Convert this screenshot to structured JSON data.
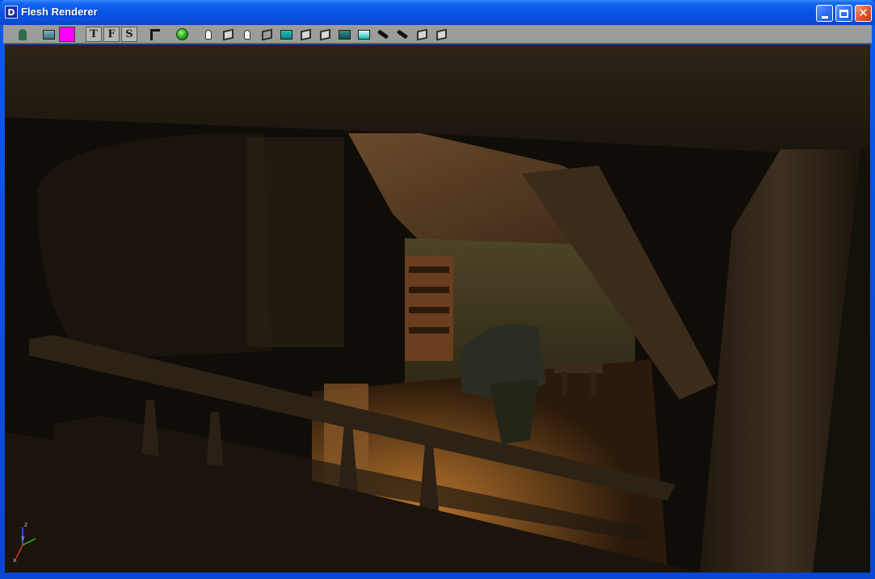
{
  "window": {
    "title": "Flesh Renderer",
    "app_icon_glyph": "D"
  },
  "titlebar_buttons": {
    "minimize_icon": "minimize-icon",
    "maximize_icon": "maximize-icon",
    "close_icon": "close-icon",
    "close_glyph": "✕"
  },
  "toolbar": {
    "tools": [
      {
        "name": "person-tool",
        "icon": "person-icon"
      },
      {
        "name": "paint-tool",
        "icon": "bucket-icon"
      },
      {
        "name": "color-swatch",
        "icon": "color-swatch-icon",
        "color": "#ff00ff"
      },
      {
        "name": "top-view",
        "label": "T"
      },
      {
        "name": "front-view",
        "label": "F"
      },
      {
        "name": "side-view",
        "label": "S"
      },
      {
        "name": "stamp-tool",
        "icon": "stamp-icon"
      },
      {
        "name": "render-toggle",
        "icon": "green-circle-icon"
      },
      {
        "name": "light-100",
        "icon": "bulb-icon"
      },
      {
        "name": "object-tool",
        "icon": "cube-icon"
      },
      {
        "name": "light-tool",
        "icon": "bulb-icon"
      },
      {
        "name": "wireframe-tool",
        "icon": "cube-icon"
      },
      {
        "name": "scale-tool",
        "icon": "cube-icon"
      },
      {
        "name": "camera-tool",
        "icon": "cube-icon"
      },
      {
        "name": "layer-tool",
        "icon": "cube-icon"
      },
      {
        "name": "texture-tool",
        "icon": "image-icon"
      },
      {
        "name": "terrain-tool",
        "icon": "terrain-icon"
      },
      {
        "name": "pick-tool",
        "icon": "arrow-icon"
      },
      {
        "name": "move-tool",
        "icon": "arrow-icon"
      },
      {
        "name": "box-tool",
        "icon": "cube-icon"
      },
      {
        "name": "flat-tool",
        "icon": "cube-icon"
      }
    ]
  },
  "viewport": {
    "axis_x": "x",
    "axis_y": "y",
    "axis_z": "z",
    "colors": {
      "x_axis": "#e03030",
      "y_axis": "#30c030",
      "z_axis": "#3060ff"
    }
  }
}
